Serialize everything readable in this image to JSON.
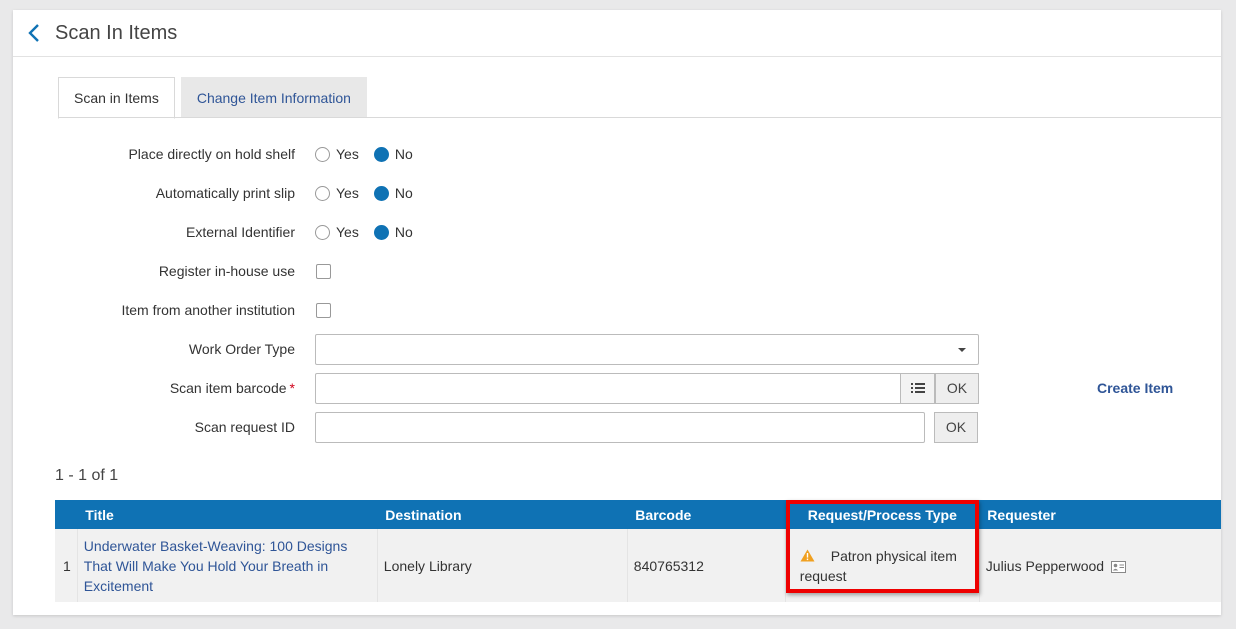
{
  "header": {
    "title": "Scan In Items"
  },
  "tabs": [
    {
      "label": "Scan in Items",
      "active": true
    },
    {
      "label": "Change Item Information",
      "active": false
    }
  ],
  "form": {
    "hold_shelf": {
      "label": "Place directly on hold shelf",
      "yes": "Yes",
      "no": "No",
      "selected": "No"
    },
    "print_slip": {
      "label": "Automatically print slip",
      "yes": "Yes",
      "no": "No",
      "selected": "No"
    },
    "external_id": {
      "label": "External Identifier",
      "yes": "Yes",
      "no": "No",
      "selected": "No"
    },
    "in_house": {
      "label": "Register in-house use",
      "checked": false
    },
    "another_institution": {
      "label": "Item from another institution",
      "checked": false
    },
    "work_order": {
      "label": "Work Order Type",
      "value": ""
    },
    "barcode": {
      "label": "Scan item barcode",
      "required_mark": "*",
      "value": "",
      "ok": "OK"
    },
    "request_id": {
      "label": "Scan request ID",
      "value": "",
      "ok": "OK"
    }
  },
  "create_item": "Create Item",
  "results": {
    "count": "1 - 1 of 1",
    "columns": [
      "Title",
      "Destination",
      "Barcode",
      "Request/Process Type",
      "Requester"
    ],
    "rows": [
      {
        "index": "1",
        "title": "Underwater Basket-Weaving: 100 Designs That Will Make You Hold Your Breath in Excitement",
        "destination": "Lonely Library",
        "barcode": "840765312",
        "request_type": "Patron physical item request",
        "requester": "Julius Pepperwood"
      }
    ]
  },
  "colors": {
    "accent": "#0f72b4",
    "link": "#2f5597",
    "highlight": "#ee0000",
    "warning": "#f0a020"
  },
  "icons": [
    "back-chevron-icon",
    "list-icon",
    "warning-icon",
    "contact-card-icon",
    "dropdown-caret-icon"
  ]
}
